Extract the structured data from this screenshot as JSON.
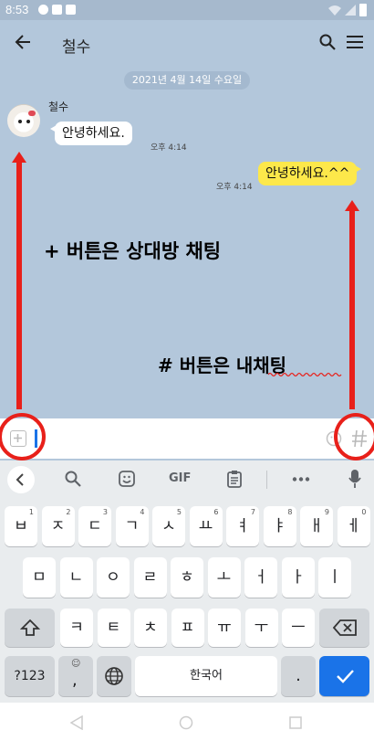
{
  "status": {
    "time": "8:53"
  },
  "header": {
    "title": "철수"
  },
  "chat": {
    "date_chip": "2021년 4월 14일 수요일",
    "sender": "철수",
    "incoming": {
      "text": "안녕하세요.",
      "time": "오후 4:14"
    },
    "outgoing": {
      "text": "안녕하세요.^^",
      "time": "오후 4:14"
    }
  },
  "annotations": {
    "note_left": "+ 버튼은 상대방 채팅",
    "note_right": "# 버튼은 내채팅",
    "color": "#e8201a"
  },
  "keyboard": {
    "toolbar": {
      "gif": "GIF"
    },
    "row1": [
      {
        "k": "ㅂ",
        "h": "1"
      },
      {
        "k": "ㅈ",
        "h": "2"
      },
      {
        "k": "ㄷ",
        "h": "3"
      },
      {
        "k": "ㄱ",
        "h": "4"
      },
      {
        "k": "ㅅ",
        "h": "5"
      },
      {
        "k": "ㅛ",
        "h": "6"
      },
      {
        "k": "ㅕ",
        "h": "7"
      },
      {
        "k": "ㅑ",
        "h": "8"
      },
      {
        "k": "ㅐ",
        "h": "9"
      },
      {
        "k": "ㅔ",
        "h": "0"
      }
    ],
    "row2": [
      "ㅁ",
      "ㄴ",
      "ㅇ",
      "ㄹ",
      "ㅎ",
      "ㅗ",
      "ㅓ",
      "ㅏ",
      "ㅣ"
    ],
    "row3": [
      "ㅋ",
      "ㅌ",
      "ㅊ",
      "ㅍ",
      "ㅠ",
      "ㅜ",
      "ㅡ"
    ],
    "symbols": "?123",
    "comma": ",",
    "comma_hint": "☺",
    "space": "한국어",
    "period": "."
  },
  "colors": {
    "chat_bg": "#b3c7db",
    "outgoing_bubble": "#fde84a",
    "enter_key": "#1a73e8"
  }
}
